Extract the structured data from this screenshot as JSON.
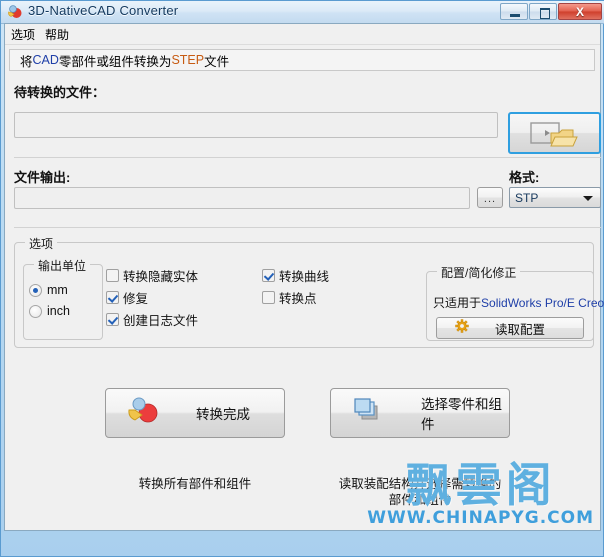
{
  "window": {
    "title": "3D-NativeCAD Converter",
    "icon": "app-sphere-icon",
    "controls": {
      "minimize": "minimize-button",
      "maximize": "maximize-button",
      "close_label": "X"
    }
  },
  "menu": {
    "items": [
      {
        "label": "选项",
        "name": "menu-options"
      },
      {
        "label": "帮助",
        "name": "menu-help"
      }
    ]
  },
  "subtitle": {
    "prefix": "将",
    "cad": "CAD",
    "middle": "零部件或组件转换为",
    "step": "STEP",
    "suffix": "文件"
  },
  "input_file": {
    "label": "待转换的文件：",
    "value": "",
    "placeholder": "",
    "browse_icon": "folder-open-icon"
  },
  "output_file": {
    "label": "文件输出:",
    "value": "",
    "placeholder": "",
    "browse_label": "...",
    "format_label": "格式:",
    "format_value": "STP",
    "format_options": [
      "STP"
    ]
  },
  "options": {
    "group_title": "选项",
    "units": {
      "group_title": "输出单位",
      "selected": "mm",
      "items": [
        {
          "label": "mm",
          "selected": true
        },
        {
          "label": "inch",
          "selected": false
        }
      ]
    },
    "checkboxes_col1": [
      {
        "label": "转换隐藏实体",
        "checked": false
      },
      {
        "label": "修复",
        "checked": true
      },
      {
        "label": "创建日志文件",
        "checked": true
      }
    ],
    "checkboxes_col2": [
      {
        "label": "转换曲线",
        "checked": true
      },
      {
        "label": "转换点",
        "checked": false
      }
    ],
    "config": {
      "group_title": "配置/简化修正",
      "note_prefix": "只适用于",
      "note_apps": "SolidWorks Pro/E Creo",
      "button_label": "读取配置",
      "button_icon": "gear-icon"
    }
  },
  "actions": {
    "convert": {
      "label": "转换完成",
      "icon": "convert-spheres-icon",
      "caption": "转换所有部件和组件"
    },
    "select_parts": {
      "label": "选择零件和组件",
      "icon": "cubes-icon",
      "caption_line1": "读取装配结构并选择需转换的",
      "caption_line2": "部件和组件"
    }
  },
  "watermark": {
    "chinese": "飘雲阁",
    "url": "WWW.CHINAPYG.COM"
  },
  "colors": {
    "accent_blue": "#2f9fe0",
    "cad_blue": "#1f3fa8",
    "step_orange": "#c75b12",
    "watermark_blue": "#5fb0e0",
    "close_red": "#cf3f2c"
  }
}
